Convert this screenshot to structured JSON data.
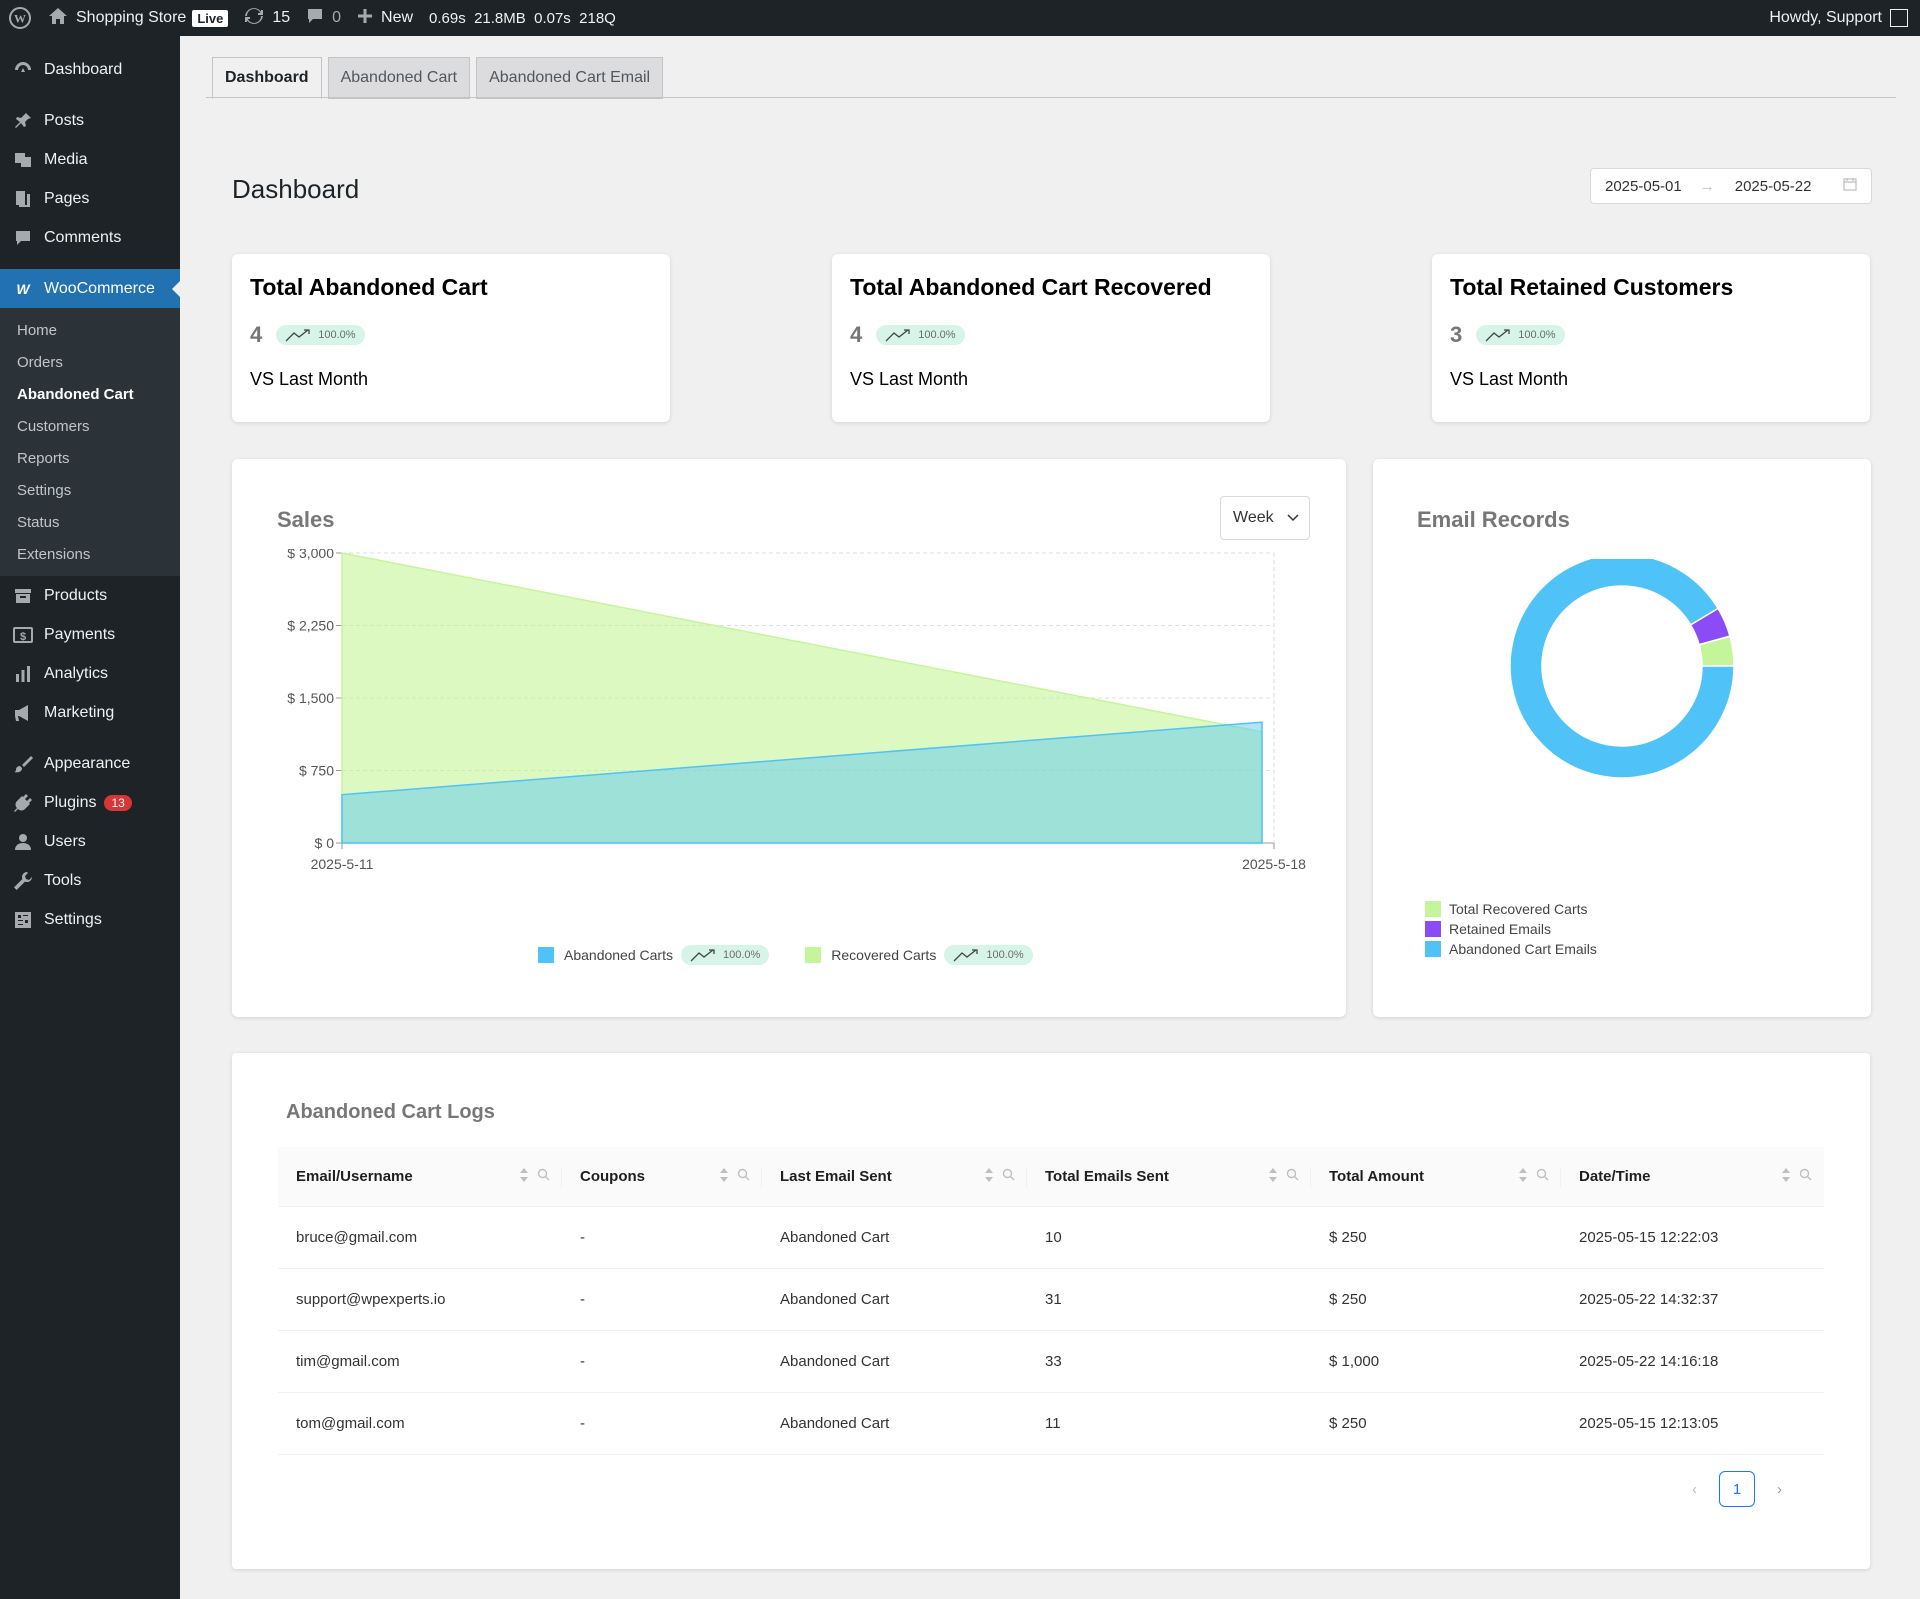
{
  "adminbar": {
    "site_name": "Shopping Store",
    "live_label": "Live",
    "updates_count": "15",
    "comments_count": "0",
    "new_label": "New",
    "query_monitor": "0.69s  21.8MB  0.07s  218Q",
    "howdy": "Howdy, Support"
  },
  "sidebar": {
    "top": [
      {
        "label": "Dashboard",
        "icon": "dashboard-icon"
      },
      {
        "label": "Posts",
        "icon": "pin-icon"
      },
      {
        "label": "Media",
        "icon": "media-icon"
      },
      {
        "label": "Pages",
        "icon": "pages-icon"
      },
      {
        "label": "Comments",
        "icon": "comments-icon"
      }
    ],
    "woocommerce": "WooCommerce",
    "submenu": [
      "Home",
      "Orders",
      "Abandoned Cart",
      "Customers",
      "Reports",
      "Settings",
      "Status",
      "Extensions"
    ],
    "bottom": [
      {
        "label": "Products",
        "icon": "archive-icon"
      },
      {
        "label": "Payments",
        "icon": "money-icon"
      },
      {
        "label": "Analytics",
        "icon": "chart-bar-icon"
      },
      {
        "label": "Marketing",
        "icon": "megaphone-icon"
      },
      {
        "label": "Appearance",
        "icon": "brush-icon"
      },
      {
        "label": "Plugins",
        "icon": "plugin-icon",
        "badge": "13"
      },
      {
        "label": "Users",
        "icon": "users-icon"
      },
      {
        "label": "Tools",
        "icon": "wrench-icon"
      },
      {
        "label": "Settings",
        "icon": "settings-icon"
      }
    ]
  },
  "tabs": [
    "Dashboard",
    "Abandoned Cart",
    "Abandoned Cart Email"
  ],
  "page_title": "Dashboard",
  "date_range": {
    "start": "2025-05-01",
    "end": "2025-05-22"
  },
  "stats": [
    {
      "title": "Total Abandoned Cart",
      "value": "4",
      "change": "100.0%",
      "sub": "VS Last Month"
    },
    {
      "title": "Total Abandoned Cart Recovered",
      "value": "4",
      "change": "100.0%",
      "sub": "VS Last Month"
    },
    {
      "title": "Total Retained Customers",
      "value": "3",
      "change": "100.0%",
      "sub": "VS Last Month"
    }
  ],
  "sales": {
    "title": "Sales",
    "period": "Week",
    "legend": [
      {
        "name": "Abandoned Carts",
        "change": "100.0%"
      },
      {
        "name": "Recovered Carts",
        "change": "100.0%"
      }
    ]
  },
  "chart_data": [
    {
      "type": "area",
      "title": "Sales",
      "x": [
        "2025-5-11",
        "2025-5-18"
      ],
      "ylim": [
        0,
        3000
      ],
      "yticks": [
        "$ 0",
        "$ 750",
        "$ 1,500",
        "$ 2,250",
        "$ 3,000"
      ],
      "yvalues": [
        0,
        750,
        1500,
        2250,
        3000
      ],
      "series": [
        {
          "name": "Abandoned Carts",
          "values": [
            500,
            1250
          ],
          "color": "#4fc3f7"
        },
        {
          "name": "Recovered Carts",
          "values": [
            3000,
            1150
          ],
          "color": "#c5f59a"
        }
      ],
      "grid": true
    },
    {
      "type": "pie",
      "title": "Email Records",
      "categories": [
        "Total Recovered Carts",
        "Retained Emails",
        "Abandoned Cart Emails"
      ],
      "values": [
        4,
        4,
        85
      ],
      "colors": [
        "#c5f59a",
        "#8b4cf7",
        "#4fc3f7"
      ]
    }
  ],
  "email_records": {
    "title": "Email Records",
    "legend": [
      "Total Recovered Carts",
      "Retained Emails",
      "Abandoned Cart Emails"
    ]
  },
  "logs": {
    "title": "Abandoned Cart Logs",
    "columns": [
      "Email/Username",
      "Coupons",
      "Last Email Sent",
      "Total Emails Sent",
      "Total Amount",
      "Date/Time"
    ],
    "rows": [
      [
        "bruce@gmail.com",
        "-",
        "Abandoned Cart",
        "10",
        "$ 250",
        "2025-05-15 12:22:03"
      ],
      [
        "support@wpexperts.io",
        "-",
        "Abandoned Cart",
        "31",
        "$ 250",
        "2025-05-22 14:32:37"
      ],
      [
        "tim@gmail.com",
        "-",
        "Abandoned Cart",
        "33",
        "$ 1,000",
        "2025-05-22 14:16:18"
      ],
      [
        "tom@gmail.com",
        "-",
        "Abandoned Cart",
        "11",
        "$ 250",
        "2025-05-15 12:13:05"
      ]
    ],
    "page": "1"
  }
}
